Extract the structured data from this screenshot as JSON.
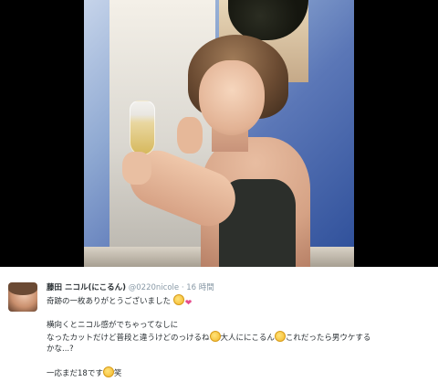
{
  "tweet": {
    "display_name": "藤田 ニコル(にこるん)",
    "handle": "@0220nicole",
    "separator": "·",
    "time": "16 時間",
    "line1": "奇跡の一枚ありがとうございました",
    "line2": "横向くとニコル感がでちゃってなしに",
    "line3a": "なったカットだけど普段と違うけどのっけるね",
    "line3b": "大人ににこるん",
    "line3c": "これだったら男ウケする",
    "line4": "かな...?",
    "line5a": "一応まだ18です",
    "line5b": "笑"
  },
  "icons": {
    "avatar": "profile-photo",
    "emoji_face": "pensive-face-emoji",
    "emoji_heart": "two-hearts-emoji"
  },
  "colors": {
    "name_text": "#292f33",
    "meta_text": "#8899a6",
    "photo_sky": "#5b77b7"
  }
}
